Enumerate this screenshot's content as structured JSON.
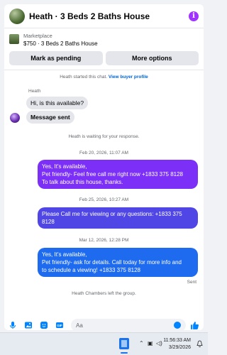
{
  "header": {
    "title": "Heath · 3 Beds 2 Baths House",
    "info_icon": "info-icon"
  },
  "listing": {
    "category": "Marketplace",
    "price_title": "$750 · 3 Beds 2 Baths House",
    "mark_pending_label": "Mark as pending",
    "more_options_label": "More options"
  },
  "chat": {
    "started_text": "Heath started this chat.",
    "view_profile_label": "View buyer profile",
    "sender_name": "Heath",
    "incoming_1": "Hi, is this available?",
    "incoming_2": "Message sent",
    "waiting_text": "Heath is waiting for your response.",
    "timestamp_1": "Feb 20, 2026, 11:07 AM",
    "outgoing_1": [
      "Yes, It's available,",
      "Pet friendly- Feel free call me right now +1833 375 8128",
      "To talk about this house, thanks."
    ],
    "timestamp_2": "Feb 25, 2026, 10:27 AM",
    "outgoing_2": [
      "Please Call me for viewing or any questions: +1833 375",
      "8128"
    ],
    "timestamp_3": "Mar 12, 2026, 12:28 PM",
    "outgoing_3": [
      "Yes, It's available,",
      "Pet friendly- ask for details. Call today for more info and",
      "to schedule a viewing!  +1833 375 8128"
    ],
    "sent_label": "Sent",
    "left_text": "Heath Chambers left the group."
  },
  "composer": {
    "placeholder": "Aa"
  },
  "taskbar": {
    "time": "11:56:33 AM",
    "date": "3/29/2026"
  },
  "colors": {
    "accent_blue": "#0084ff",
    "bubble_purple": "#7b2ff7",
    "bubble_indigo": "#4f46e5",
    "bubble_blue": "#1e6bf0",
    "info_purple": "#a033ff"
  }
}
